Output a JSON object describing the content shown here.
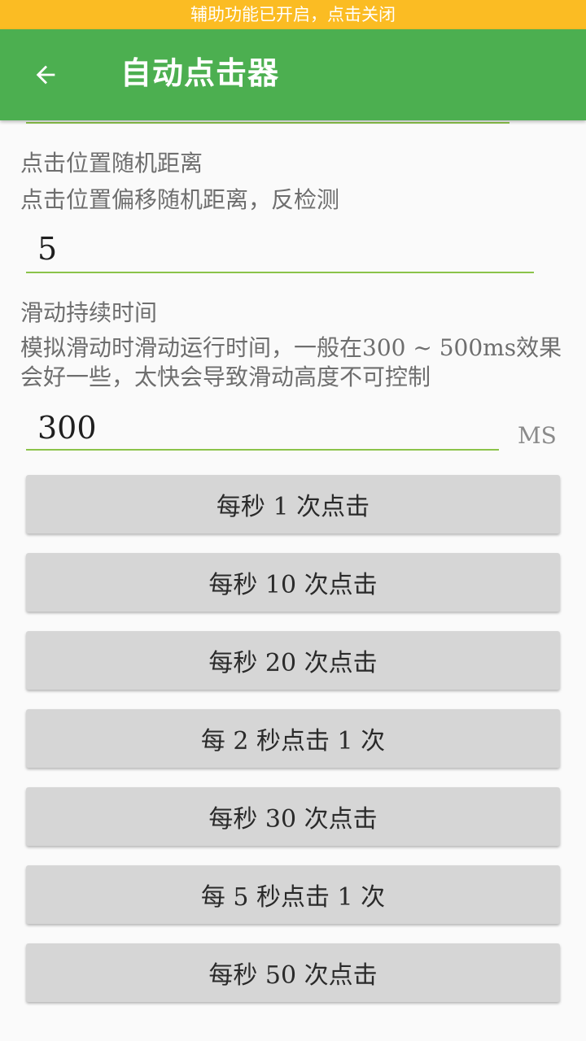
{
  "status_banner": "辅助功能已开启，点击关闭",
  "app_bar": {
    "title": "自动点击器",
    "back_icon": "arrow-back-icon"
  },
  "random_distance": {
    "label": "点击位置随机距离",
    "description": "点击位置偏移随机距离，反检测",
    "value": "5"
  },
  "swipe_duration": {
    "label": "滑动持续时间",
    "description": "模拟滑动时滑动运行时间，一般在300 ~ 500ms效果会好一些，太快会导致滑动高度不可控制",
    "value": "300",
    "unit": "MS"
  },
  "buttons": [
    "每秒 1 次点击",
    "每秒 10 次点击",
    "每秒 20 次点击",
    "每 2 秒点击 1 次",
    "每秒 30 次点击",
    "每 5 秒点击 1 次",
    "每秒 50 次点击"
  ],
  "colors": {
    "banner": "#fbbc23",
    "app_bar": "#4caf50",
    "underline": "#8bc34a",
    "button": "#d6d6d6"
  }
}
